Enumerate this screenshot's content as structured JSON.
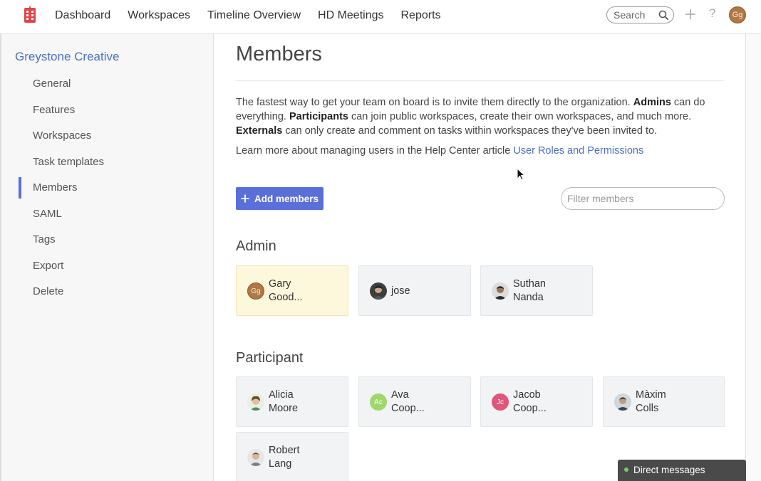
{
  "topbar": {
    "nav": [
      "Dashboard",
      "Workspaces",
      "Timeline Overview",
      "HD Meetings",
      "Reports"
    ],
    "search_placeholder": "Search",
    "help_label": "?",
    "user_initials": "Gg"
  },
  "sidebar": {
    "org_name": "Greystone Creative",
    "items": [
      "General",
      "Features",
      "Workspaces",
      "Task templates",
      "Members",
      "SAML",
      "Tags",
      "Export",
      "Delete"
    ],
    "active": "Members"
  },
  "main": {
    "title": "Members",
    "intro": {
      "t1": "The fastest way to get your team on board is to invite them directly to the organization. ",
      "b1": "Admins",
      "t2": " can do everything. ",
      "b2": "Participants",
      "t3": " can join public workspaces, create their own workspaces, and much more. ",
      "b3": "Externals",
      "t4": " can only create and comment on tasks within workspaces they've been invited to."
    },
    "learn_more": {
      "text": "Learn more about managing users in the Help Center article ",
      "link": "User Roles and Permissions"
    },
    "add_button": "Add members",
    "filter_placeholder": "Filter members",
    "admin_heading": "Admin",
    "participant_heading": "Participant",
    "admins": [
      {
        "line1": "Gary",
        "line2": "Good...",
        "initials": "Gg"
      },
      {
        "line1": "jose",
        "line2": ""
      },
      {
        "line1": "Suthan",
        "line2": "Nanda"
      }
    ],
    "participants": [
      {
        "line1": "Alicia",
        "line2": "Moore"
      },
      {
        "line1": "Ava",
        "line2": "Coop...",
        "initials": "Ac"
      },
      {
        "line1": "Jacob",
        "line2": "Coop...",
        "initials": "Jc"
      },
      {
        "line1": "Màxim",
        "line2": "Colls"
      },
      {
        "line1": "Robert",
        "line2": "Lang"
      }
    ]
  },
  "direct_messages": "Direct messages",
  "colors": {
    "accent": "#5a6fd8",
    "link": "#4a6fc2",
    "highlight_card": "#fdf8dc",
    "online": "#6ccf6c"
  }
}
